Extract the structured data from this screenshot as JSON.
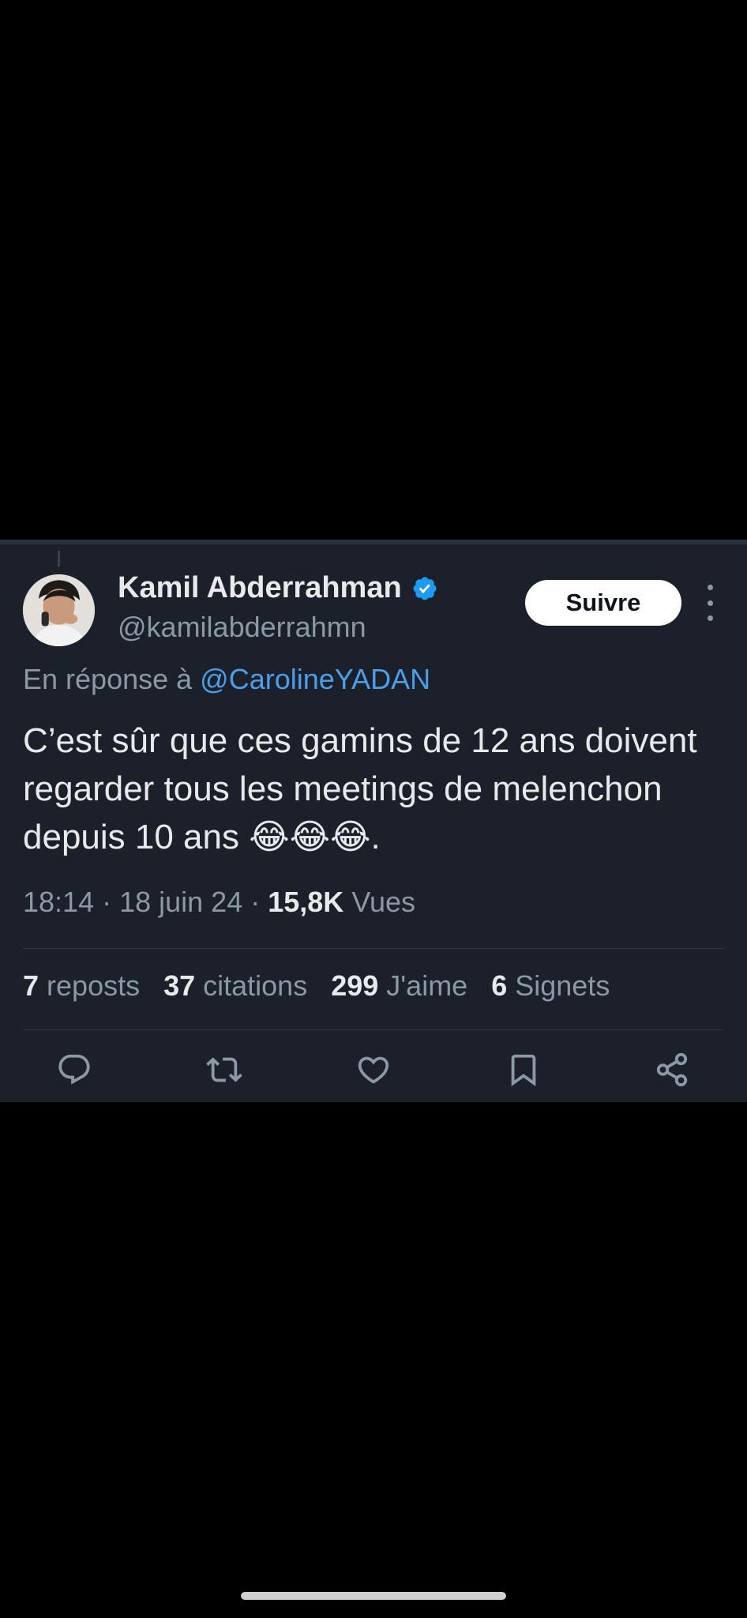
{
  "tweet": {
    "author": {
      "name": "Kamil Abderrahman",
      "handle": "@kamilabderrahmn",
      "verified": true
    },
    "follow_label": "Suivre",
    "reply_prefix": "En réponse à ",
    "reply_mention": "@CarolineYADAN",
    "text": "C’est sûr que ces gamins de 12 ans doivent regarder tous les meetings de melenchon depuis 10 ans 😂😂😂.",
    "time": "18:14",
    "separator": " · ",
    "date": "18 juin 24",
    "views_count": "15,8K",
    "views_label": " Vues",
    "stats": [
      {
        "count": "7",
        "label": " reposts"
      },
      {
        "count": "37",
        "label": " citations"
      },
      {
        "count": "299",
        "label": " J'aime"
      },
      {
        "count": "6",
        "label": " Signets"
      }
    ],
    "actions": [
      "reply-icon",
      "repost-icon",
      "like-icon",
      "bookmark-icon",
      "share-icon"
    ]
  },
  "colors": {
    "background": "#000000",
    "card": "#1b202a",
    "primary_text": "#e7e9ea",
    "secondary_text": "#8b98a5",
    "mention": "#4c9ee8",
    "verified_badge": "#1d9bf0"
  }
}
